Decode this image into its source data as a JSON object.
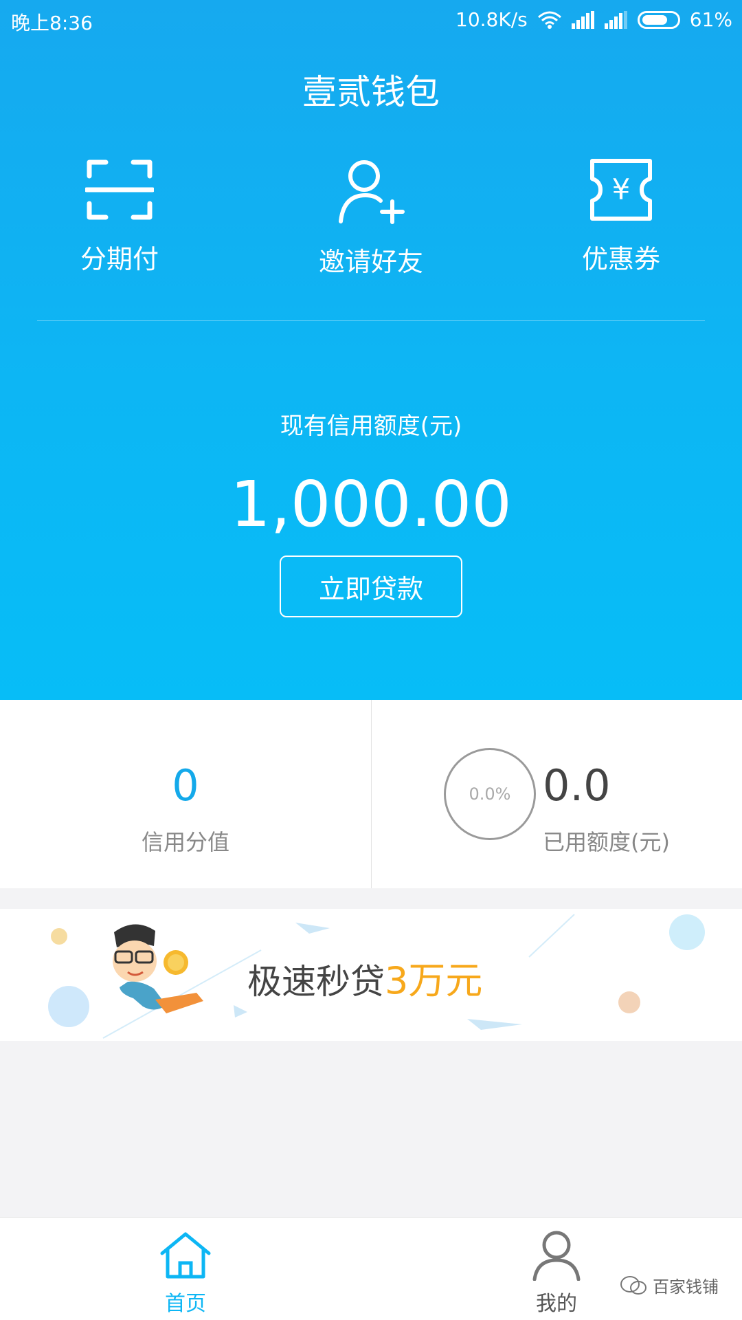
{
  "status": {
    "time": "晚上8:36",
    "speed": "10.8K/s",
    "battery": "61%"
  },
  "title": "壹贰钱包",
  "actions": [
    {
      "label": "分期付",
      "icon": "scan-icon"
    },
    {
      "label": "邀请好友",
      "icon": "add-user-icon"
    },
    {
      "label": "优惠券",
      "icon": "coupon-icon"
    }
  ],
  "credit": {
    "label": "现有信用额度(元)",
    "amount": "1,000.00",
    "button": "立即贷款"
  },
  "stats": {
    "score_value": "0",
    "score_label": "信用分值",
    "used_percent": "0.0%",
    "used_value": "0.0",
    "used_label": "已用额度(元)"
  },
  "banner": {
    "text": "极速秒贷",
    "highlight": "3",
    "unit": "万元"
  },
  "tabs": [
    {
      "label": "首页",
      "icon": "home-icon",
      "active": true
    },
    {
      "label": "我的",
      "icon": "user-icon",
      "active": false
    }
  ],
  "watermark": "百家钱铺",
  "colors": {
    "primary": "#0db6f4",
    "accent": "#f7a81b",
    "score": "#14a9ea"
  }
}
